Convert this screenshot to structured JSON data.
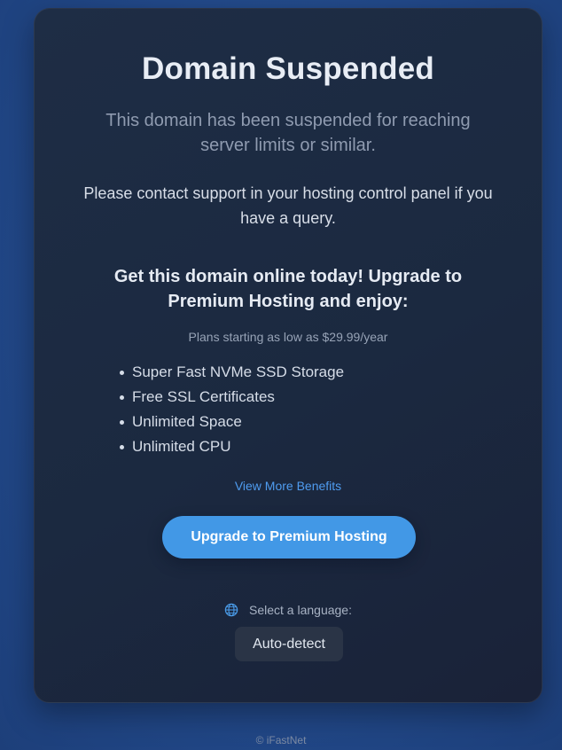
{
  "card": {
    "title": "Domain Suspended",
    "subtitle": "This domain has been suspended for reaching server limits or similar.",
    "contact": "Please contact support in your hosting control panel if you have a query.",
    "promo_heading": "Get this domain online today! Upgrade to Premium Hosting and enjoy:",
    "plans_text": "Plans starting as low as $29.99/year",
    "benefits": [
      "Super Fast NVMe SSD Storage",
      "Free SSL Certificates",
      "Unlimited Space",
      "Unlimited CPU"
    ],
    "more_link": "View More Benefits",
    "upgrade_button": "Upgrade to Premium Hosting",
    "language": {
      "icon": "globe-icon",
      "label": "Select a language:",
      "selected": "Auto-detect"
    }
  },
  "footer": "© iFastNet",
  "colors": {
    "accent": "#4298e6",
    "link": "#4f9cf0",
    "card_bg": "#1e2d45",
    "page_bg": "#22498a"
  }
}
